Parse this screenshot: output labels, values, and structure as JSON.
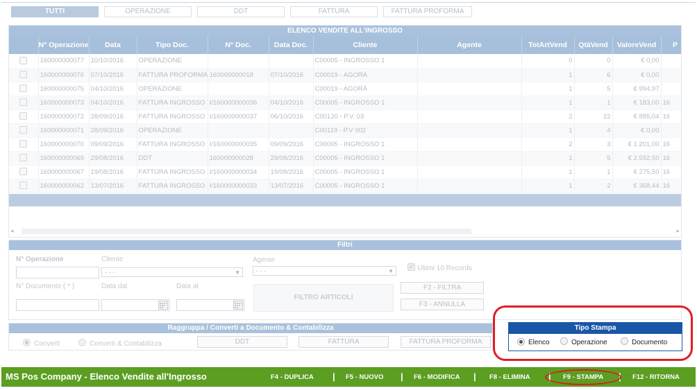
{
  "tabs": [
    "TUTTI",
    "OPERAZIONE",
    "DDT",
    "FATTURA",
    "FATTURA PROFORMA"
  ],
  "grid": {
    "title": "ELENCO VENDITE ALL'INGROSSO",
    "columns": [
      "",
      "N° Operazione",
      "Data",
      "Tipo Doc.",
      "N° Doc.",
      "Data Doc.",
      "Cliente",
      "Agente",
      "TotArtVend",
      "QtàVend",
      "ValoreVend",
      "P"
    ],
    "rows": [
      [
        "160000000077",
        "10/10/2016",
        "OPERAZIONE",
        "",
        "",
        "C00005 - INGROSSO 1",
        "",
        "0",
        "0",
        "€ 0,00",
        ""
      ],
      [
        "160000000076",
        "07/10/2016",
        "FATTURA PROFORMA",
        "160000000018",
        "07/10/2016",
        "C00019 - AGORÀ",
        "",
        "1",
        "6",
        "€ 0,00",
        ""
      ],
      [
        "160000000075",
        "04/10/2016",
        "OPERAZIONE",
        "",
        "",
        "C00019 - AGORÀ",
        "",
        "1",
        "5",
        "€ 994,97",
        ""
      ],
      [
        "160000000073",
        "04/10/2016",
        "FATTURA INGROSSO",
        "I/160000000036",
        "04/10/2016",
        "C00005 - INGROSSO 1",
        "",
        "1",
        "1",
        "€ 183,00",
        "16"
      ],
      [
        "160000000072",
        "28/09/2016",
        "FATTURA INGROSSO",
        "I/160000000037",
        "06/10/2016",
        "C00120 - P.V. 03",
        "",
        "2",
        "22",
        "€ 885,04",
        "16"
      ],
      [
        "160000000071",
        "28/09/2016",
        "OPERAZIONE",
        "",
        "",
        "C00119 - P.V 002",
        "",
        "1",
        "4",
        "€ 0,00",
        ""
      ],
      [
        "160000000070",
        "09/09/2016",
        "FATTURA INGROSSO",
        "I/160000000035",
        "09/09/2016",
        "C00005 - INGROSSO 1",
        "",
        "2",
        "3",
        "€ 1.201,00",
        "16"
      ],
      [
        "160000000069",
        "29/08/2016",
        "DDT",
        "160000000028",
        "29/08/2016",
        "C00005 - INGROSSO 1",
        "",
        "1",
        "5",
        "€ 2.592,50",
        "16"
      ],
      [
        "160000000067",
        "19/08/2016",
        "FATTURA INGROSSO",
        "I/160000000034",
        "19/08/2016",
        "C00005 - INGROSSO 1",
        "",
        "1",
        "1",
        "€ 275,50",
        "16"
      ],
      [
        "160000000062",
        "13/07/2016",
        "FATTURA INGROSSO",
        "I/160000000033",
        "13/07/2016",
        "C00005 - INGROSSO 1",
        "",
        "1",
        "2",
        "€ 368,44",
        "16"
      ]
    ]
  },
  "filters": {
    "title": "Filtri",
    "n_operazione_label": "N° Operazione",
    "cliente_label": "Cliente",
    "cliente_value": "- - -",
    "agente_label": "Agente",
    "agente_value": "- - -",
    "ultimi_label": "Ultimi 10 Records",
    "n_documento_label": "N° Documento ( * )",
    "data_dal_label": "Data dal",
    "data_al_label": "Data al",
    "filtro_articoli": "FILTRO ARTICOLI",
    "filtra_button": "F2 - FILTRA",
    "annulla_button": "F3 - ANNULLA"
  },
  "group_panel": {
    "title": "Raggruppa / Converti a Documento & Contabilizza",
    "radio_converti": "Converti",
    "radio_converti_contabilizza": "Converti & Contabilizza",
    "btn_ddt": "DDT",
    "btn_fattura": "FATTURA",
    "btn_fattura_proforma": "FATTURA PROFORMA"
  },
  "tipo_stampa": {
    "title": "Tipo Stampa",
    "options": [
      "Elenco",
      "Operazione",
      "Documento"
    ],
    "selected": "Elenco"
  },
  "bottom_bar": {
    "title": "MS Pos Company - Elenco Vendite all'Ingrosso",
    "keys": [
      "F4 - DUPLICA",
      "F5 - NUOVO",
      "F6 - MODIFICA",
      "F8 - ELIMINA",
      "F9 - STAMPA",
      "F12 - RITORNA"
    ],
    "separator": "|"
  },
  "colors": {
    "bar_green": "#5b9e22",
    "header_blue": "#a6bfdb",
    "tipo_stampa_blue": "#1a56a8",
    "highlight_red": "#e01e24"
  }
}
